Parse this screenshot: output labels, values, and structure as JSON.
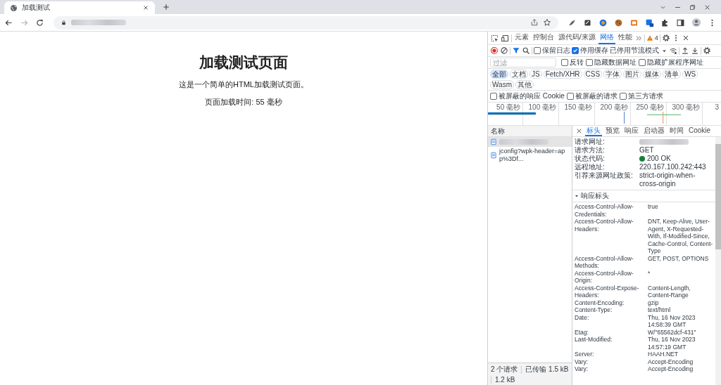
{
  "browser": {
    "tabs": [
      {
        "title": "加载测试",
        "selected": true
      }
    ]
  },
  "page": {
    "heading": "加载测试页面",
    "paragraphs": [
      "这是一个简单的HTML加载测试页面。",
      "页面加载时间: 55 毫秒"
    ]
  },
  "devtools": {
    "tabs": [
      {
        "label": "元素",
        "selected": false
      },
      {
        "label": "控制台",
        "selected": false
      },
      {
        "label": "源代码/来源",
        "selected": false
      },
      {
        "label": "网络",
        "selected": true
      },
      {
        "label": "性能",
        "selected": false
      }
    ],
    "issues_count": "4",
    "toolbar": {
      "options": [
        {
          "label": "保留日志",
          "checked": false
        },
        {
          "label": "停用缓存",
          "checked": true
        }
      ],
      "throttling": "已停用节流模式"
    },
    "filter": {
      "placeholder": "过滤",
      "options": [
        {
          "label": "反转",
          "checked": false
        },
        {
          "label": "隐藏数据网址",
          "checked": false
        },
        {
          "label": "隐藏扩展程序网址",
          "checked": false
        }
      ]
    },
    "type_filters": [
      {
        "label": "全部",
        "selected": true
      },
      {
        "label": "文档",
        "selected": false
      },
      {
        "label": "JS",
        "selected": false
      },
      {
        "label": "Fetch/XHR",
        "selected": false
      },
      {
        "label": "CSS",
        "selected": false
      },
      {
        "label": "字体",
        "selected": false
      },
      {
        "label": "图片",
        "selected": false
      },
      {
        "label": "媒体",
        "selected": false
      },
      {
        "label": "清单",
        "selected": false
      },
      {
        "label": "WS",
        "selected": false
      },
      {
        "label": "Wasm",
        "selected": false
      },
      {
        "label": "其他",
        "selected": false
      }
    ],
    "more_filters": [
      {
        "label": "被屏蔽的响应 Cookie",
        "checked": false
      },
      {
        "label": "被屏蔽的请求",
        "checked": false
      },
      {
        "label": "第三方请求",
        "checked": false
      }
    ],
    "timeline": {
      "ticks": [
        "50 毫秒",
        "100 毫秒",
        "150 毫秒",
        "200 毫秒",
        "250 毫秒",
        "300 毫秒",
        "3"
      ]
    },
    "requests": {
      "column": "名称",
      "items": [
        {
          "kind": "blurred",
          "selected": true
        },
        {
          "kind": "text",
          "name": "jconfig?wpk-header=app%3Df...",
          "selected": false
        }
      ]
    },
    "detail": {
      "tabs": [
        {
          "label": "标头",
          "selected": true
        },
        {
          "label": "预览",
          "selected": false
        },
        {
          "label": "响应",
          "selected": false
        },
        {
          "label": "启动器",
          "selected": false
        },
        {
          "label": "时间",
          "selected": false
        },
        {
          "label": "Cookie",
          "selected": false
        }
      ],
      "general": [
        {
          "key": "请求网址:",
          "kind": "blurred"
        },
        {
          "key": "请求方法:",
          "kind": "text",
          "value": "GET"
        },
        {
          "key": "状态代码:",
          "kind": "status",
          "value": "200 OK"
        },
        {
          "key": "远程地址:",
          "kind": "text",
          "value": "220.167.100.242:443"
        },
        {
          "key": "引荐来源网址政策:",
          "kind": "text",
          "value": "strict-origin-when-cross-origin"
        }
      ],
      "response_headers": {
        "title": "响应标头",
        "expanded": true,
        "rows": [
          {
            "key": "Access-Control-Allow-Credentials:",
            "value": "true"
          },
          {
            "key": "Access-Control-Allow-Headers:",
            "value": "DNT, Keep-Alive, User-Agent, X-Requested-With, If-Modified-Since, Cache-Control, Content-Type"
          },
          {
            "key": "Access-Control-Allow-Methods:",
            "value": "GET, POST, OPTIONS"
          },
          {
            "key": "Access-Control-Allow-Origin:",
            "value": "*"
          },
          {
            "key": "Access-Control-Expose-Headers:",
            "value": "Content-Length, Content-Range"
          },
          {
            "key": "Content-Encoding:",
            "value": "gzip"
          },
          {
            "key": "Content-Type:",
            "value": "text/html"
          },
          {
            "key": "Date:",
            "value": "Thu, 16 Nov 2023 14:58:39 GMT"
          },
          {
            "key": "Etag:",
            "value": "W/\"65562dcf-431\""
          },
          {
            "key": "Last-Modified:",
            "value": "Thu, 16 Nov 2023 14:57:19 GMT"
          },
          {
            "key": "Server:",
            "value": "HAAH.NET"
          },
          {
            "key": "Vary:",
            "value": "Accept-Encoding"
          },
          {
            "key": "Vary:",
            "value": "Accept-Encoding"
          }
        ]
      }
    },
    "status_bar": [
      "2 个请求",
      "已传输 1.5 kB",
      "1.2 kB"
    ]
  }
}
